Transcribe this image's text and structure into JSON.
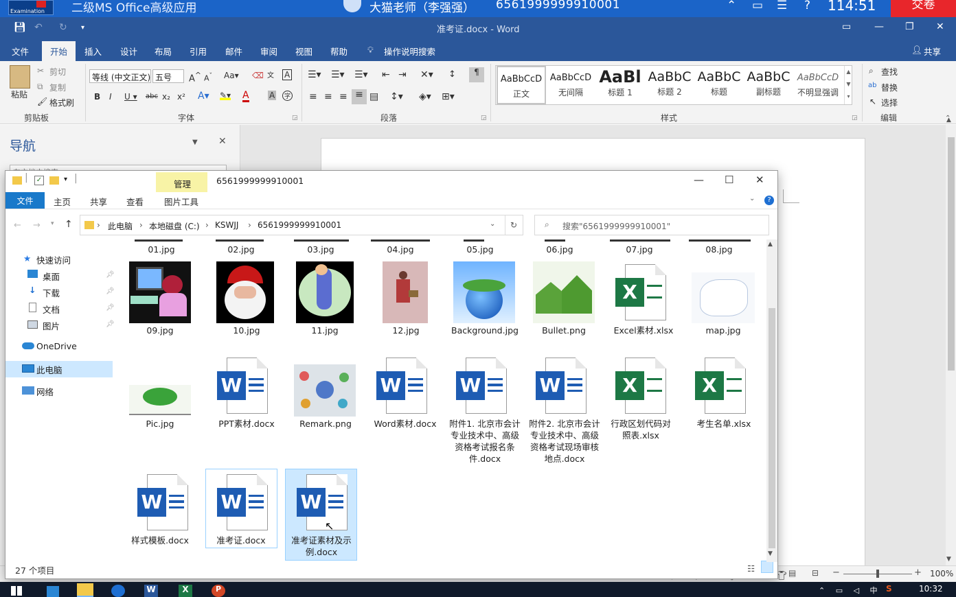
{
  "exam_bar": {
    "logo_text": "Examination",
    "title": "二级MS Office高级应用",
    "teacher": "大猫老师（李强强）",
    "ticket": "6561999999910001",
    "time": "114:51",
    "submit": "交卷"
  },
  "word": {
    "doc_title": "准考证.docx - Word",
    "tabs": [
      "文件",
      "开始",
      "插入",
      "设计",
      "布局",
      "引用",
      "邮件",
      "审阅",
      "视图",
      "帮助"
    ],
    "tell_me": "操作说明搜索",
    "share": "共享",
    "clipboard": {
      "paste": "粘贴",
      "cut": "剪切",
      "copy": "复制",
      "format_painter": "格式刷",
      "group": "剪贴板"
    },
    "font": {
      "name": "等线 (中文正文)",
      "size": "五号",
      "group": "字体"
    },
    "paragraph": {
      "group": "段落"
    },
    "styles": {
      "group": "样式",
      "items": [
        {
          "preview": "AaBbCcD",
          "name": "正文"
        },
        {
          "preview": "AaBbCcD",
          "name": "无间隔"
        },
        {
          "preview": "AaBl",
          "name": "标题 1"
        },
        {
          "preview": "AaBbC",
          "name": "标题 2"
        },
        {
          "preview": "AaBbC",
          "name": "标题"
        },
        {
          "preview": "AaBbC",
          "name": "副标题"
        },
        {
          "preview": "AaBbCcD",
          "name": "不明显强调"
        }
      ]
    },
    "editing": {
      "find": "查找",
      "replace": "替换",
      "select": "选择",
      "group": "编辑"
    },
    "nav": {
      "title": "导航",
      "search_placeholder": "在文档中搜索"
    },
    "zoom": "100%"
  },
  "explorer": {
    "manage_tab": "管理",
    "path_title": "6561999999910001",
    "ribbon_tabs": [
      "文件",
      "主页",
      "共享",
      "查看",
      "图片工具"
    ],
    "address": [
      "此电脑",
      "本地磁盘 (C:)",
      "KSWJJ",
      "6561999999910001"
    ],
    "search_placeholder": "搜索\"6561999999910001\"",
    "nav": {
      "quick_access": "快速访问",
      "desktop": "桌面",
      "downloads": "下载",
      "documents": "文档",
      "pictures": "图片",
      "onedrive": "OneDrive",
      "this_pc": "此电脑",
      "network": "网络"
    },
    "status": "27 个项目",
    "row0": [
      "01.jpg",
      "02.jpg",
      "03.jpg",
      "04.jpg",
      "05.jpg",
      "06.jpg",
      "07.jpg",
      "08.jpg"
    ],
    "row1": [
      "09.jpg",
      "10.jpg",
      "11.jpg",
      "12.jpg",
      "Background.jpg",
      "Bullet.png",
      "Excel素材.xlsx",
      "map.jpg"
    ],
    "row2": [
      "Pic.jpg",
      "PPT素材.docx",
      "Remark.png",
      "Word素材.docx",
      "附件1. 北京市会计专业技术中、高级资格考试报名条件.docx",
      "附件2. 北京市会计专业技术中、高级资格考试现场审核地点.docx",
      "行政区划代码对照表.xlsx",
      "考生名单.xlsx"
    ],
    "row3": [
      "样式模板.docx",
      "准考证.docx",
      "准考证素材及示例.docx"
    ]
  },
  "taskbar": {
    "clock": "10:32"
  }
}
